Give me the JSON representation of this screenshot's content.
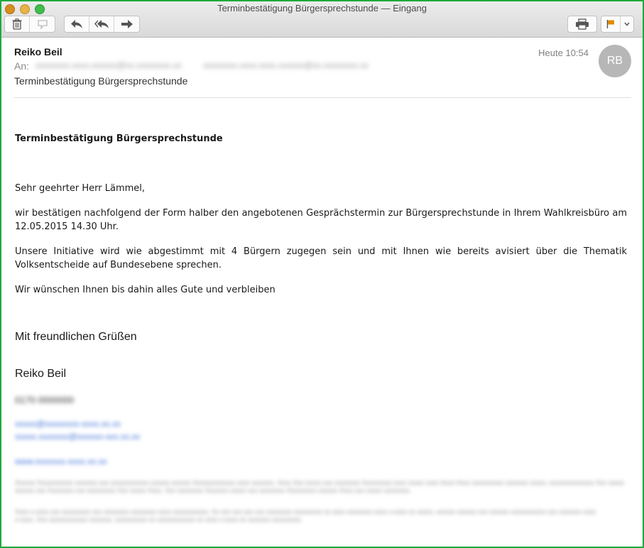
{
  "window": {
    "title": "Terminbestätigung Bürgersprechstunde — Eingang"
  },
  "toolbar": {
    "icons": [
      "trash-icon",
      "junk-icon",
      "reply-icon",
      "reply-all-icon",
      "forward-icon",
      "print-icon",
      "flag-icon",
      "chevron-down-icon"
    ],
    "flag_color": "#e08a00"
  },
  "message": {
    "sender": "Reiko Beil",
    "to_label": "An:",
    "recipients": [
      "xxxxxxxx.xxxx.xxxxxx@xx.xxxxxxxx.xx",
      "xxxxxxxx.xxxx.xxxx.xxxxxx@xx.xxxxxxxx.xx"
    ],
    "subject": "Terminbestätigung Bürgersprechstunde",
    "date": "Heute 10:54",
    "avatar_initials": "RB"
  },
  "body": {
    "title": "Terminbestätigung Bürgersprechstunde",
    "greeting": "Sehr geehrter Herr Lämmel,",
    "paragraph1": "wir bestätigen nachfolgend der Form halber den angebotenen Gesprächstermin zur Bürgersprechstunde in Ihrem Wahlkreisbüro am 12.05.2015 14.30 Uhr.",
    "paragraph2": "Unsere Initiative wird wie abgestimmt mit 4 Bürgern zugegen sein und mit Ihnen wie bereits avisiert über die Thematik Volksentscheide auf Bundesebene sprechen.",
    "paragraph3": "Wir wünschen Ihnen bis dahin alles Gute und verbleiben",
    "closing": "Mit freundlichen Grüßen",
    "signature_name": "Reiko Beil",
    "phone": "0170 0000000",
    "link1": "xxxxx@xxxxxxxx-xxxx.xx.xx",
    "link2": "xxxxx.xxxxxxx@xxxxxx-xxx.xx.xx",
    "link3": "www.xxxxxxx-xxxx.xx.xx",
    "disclaimer1": "Xxxxxx Xxxxxxxxxxx xxxxxxx xxx xxxxxxxxxxxx xxxxxx xxxxxx Xxxxxxxxxxxxx xxxx xxxxxxx. Xxxx Xxx xxxxx xxx xxxxxxxx Xxxxxxxxx xxxx xxxxx xxxx Xxxx-Xxxx xxxxxxxxxx xxxxxxx xxxxx, xxxxxxxxxxxxxx Xxx xxxxx xxxxxx xxx Xxxxxxxx xxx xxxxxxxxx Xxx xxxxx Xxxx. Xxx xxxxxxxx Xxxxxxx xxxxx xxx xxxxxxxx Xxxxxxxxx xxxxxx Xxxx xxx xxxxx xxxxxxxx.",
    "disclaimer2": "Xxxx x-xxxx xxx xxxxxxxxx xxx xxxxxxxx xxxxxxxx xxxx xxxxxxxxxxx. Xx xxx xxx xxx xxx xxxxxxxx xxxxxxxxx xx xxxx xxxxxxxx xxxx x-xxxx xx xxxxx, xxxxxx xxxxxx xxx xxxxxx xxxxxxxxxxx xxx xxxxxxx xxxx x-xxxx. Xxx xxxxxxxxxxxx xxxxxxx, xxxxxxxxxx xx xxxxxxxxxxxx xx xxxx x-xxxx xx xxxxxxx xxxxxxxxx."
  }
}
